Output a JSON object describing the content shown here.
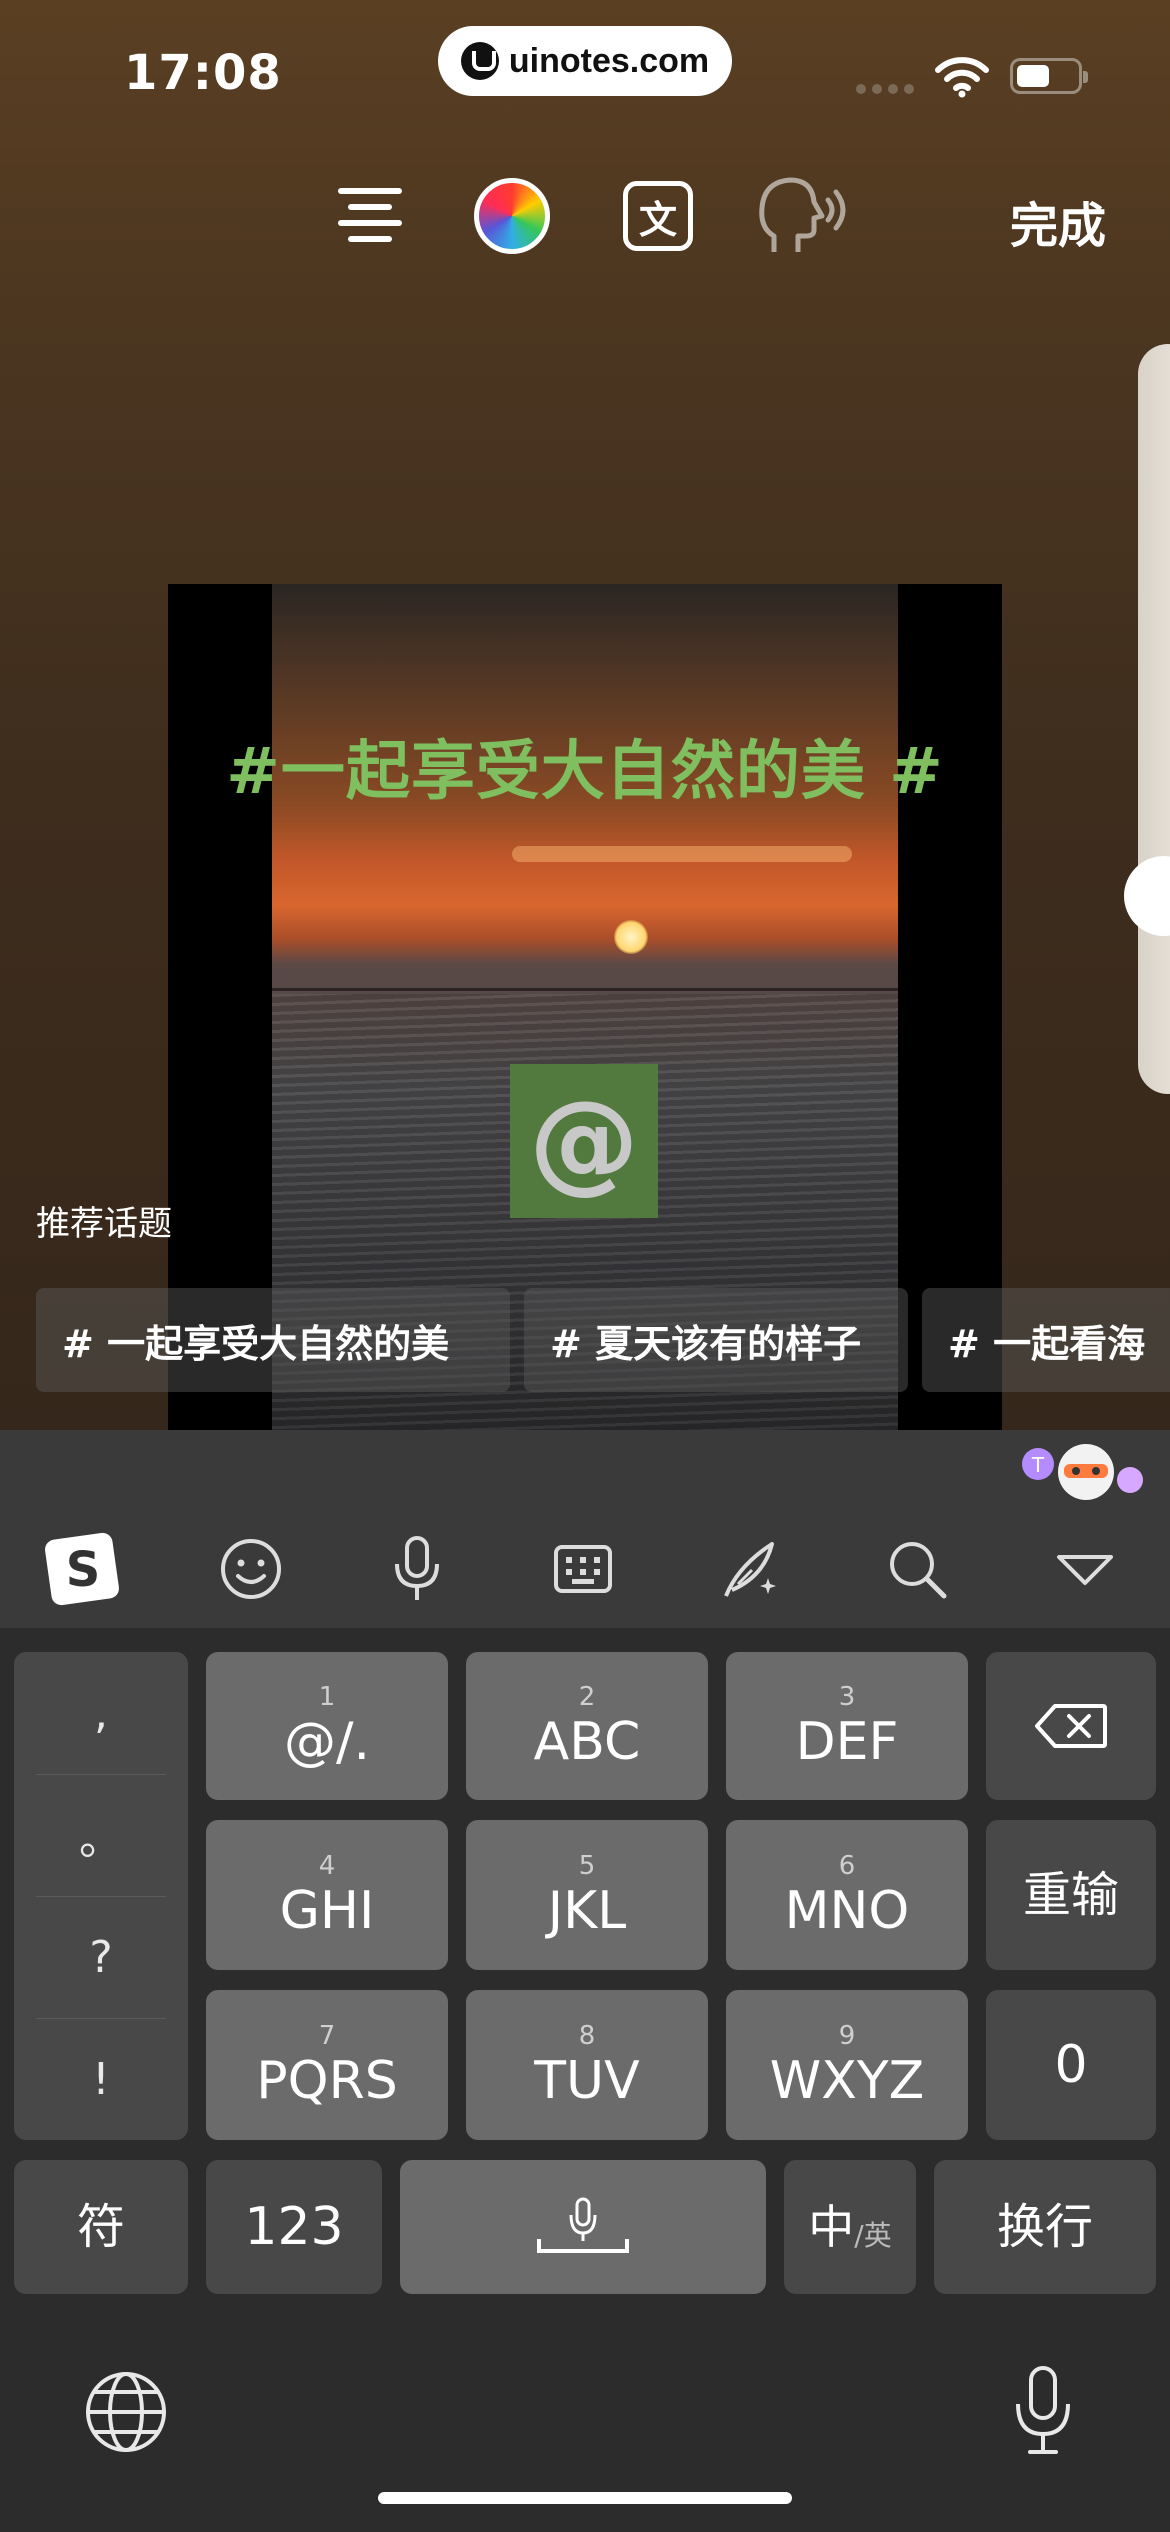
{
  "status_bar": {
    "time": "17:08",
    "url": "uinotes.com"
  },
  "toolbar": {
    "done_label": "完成",
    "translate_glyph": "文"
  },
  "canvas": {
    "hashtag_text": "#一起享受大自然的美 #",
    "mention_glyph": "@"
  },
  "topics": {
    "title": "推荐话题",
    "items": [
      {
        "label": "# 一起享受大自然的美"
      },
      {
        "label": "# 夏天该有的样子"
      },
      {
        "label": "# 一起看海"
      }
    ]
  },
  "keyboard": {
    "toolbar_icons": [
      "sogou-logo-icon",
      "emoji-icon",
      "microphone-icon",
      "keyboard-icon",
      "handwriting-pen-icon",
      "search-icon",
      "collapse-keyboard-icon"
    ],
    "punctuation": [
      ",",
      "。",
      "?",
      "!"
    ],
    "keys": [
      {
        "num": "1",
        "label": "@/."
      },
      {
        "num": "2",
        "label": "ABC"
      },
      {
        "num": "3",
        "label": "DEF"
      },
      {
        "num": "4",
        "label": "GHI"
      },
      {
        "num": "5",
        "label": "JKL"
      },
      {
        "num": "6",
        "label": "MNO"
      },
      {
        "num": "7",
        "label": "PQRS"
      },
      {
        "num": "8",
        "label": "TUV"
      },
      {
        "num": "9",
        "label": "WXYZ"
      }
    ],
    "reinput_label": "重输",
    "zero_label": "0",
    "symbol_label": "符",
    "numeric_label": "123",
    "lang_main": "中",
    "lang_sub": "/英",
    "enter_label": "换行"
  }
}
